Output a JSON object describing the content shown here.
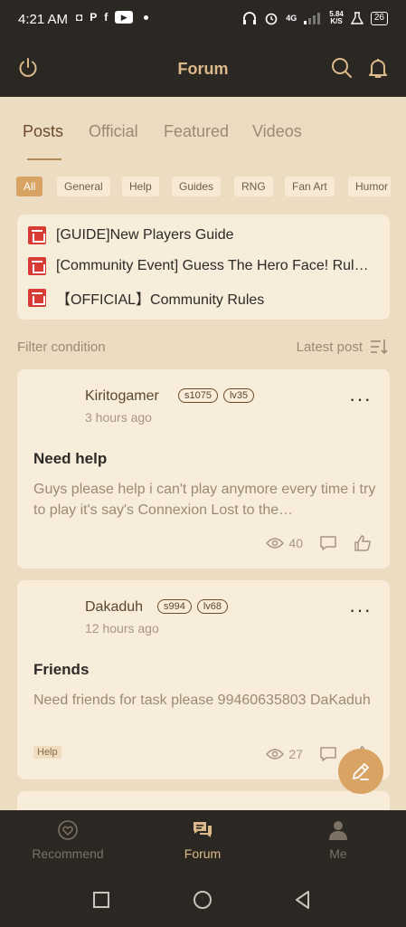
{
  "status_bar": {
    "time": "4:21 AM",
    "net_speed_value": "5.84",
    "net_speed_unit": "K/S",
    "network_type": "4G",
    "battery": "26"
  },
  "header": {
    "title": "Forum"
  },
  "tabs": [
    {
      "label": "Posts",
      "active": true
    },
    {
      "label": "Official"
    },
    {
      "label": "Featured"
    },
    {
      "label": "Videos"
    }
  ],
  "categories": [
    "All",
    "General",
    "Help",
    "Guides",
    "RNG",
    "Fan Art",
    "Humor"
  ],
  "pinned": [
    "[GUIDE]New Players Guide",
    "[Community Event] Guess The Hero Face! Rules & Prize",
    "【OFFICIAL】Community Rules"
  ],
  "filter": {
    "label": "Filter condition",
    "sort": "Latest post"
  },
  "posts": [
    {
      "author": "Kiritogamer",
      "server": "s1075",
      "level": "lv35",
      "time": "3 hours ago",
      "title": "Need help",
      "body": "Guys please help i can't play anymore every time i try to play it's say's Connexion Lost to the…",
      "views": "40",
      "tag": ""
    },
    {
      "author": "Dakaduh",
      "server": "s994",
      "level": "lv68",
      "time": "12 hours ago",
      "title": "Friends",
      "body": "Need friends for task please 99460635803 DaKaduh",
      "views": "27",
      "tag": "Help"
    }
  ],
  "bottom_nav": [
    {
      "label": "Recommend"
    },
    {
      "label": "Forum",
      "active": true
    },
    {
      "label": "Me"
    }
  ],
  "colors": {
    "accent": "#d9a364",
    "header_bg": "#2b2824",
    "page_bg": "#ecdcc2",
    "card_bg": "#f8ecda",
    "pin_red": "#d83b34"
  }
}
